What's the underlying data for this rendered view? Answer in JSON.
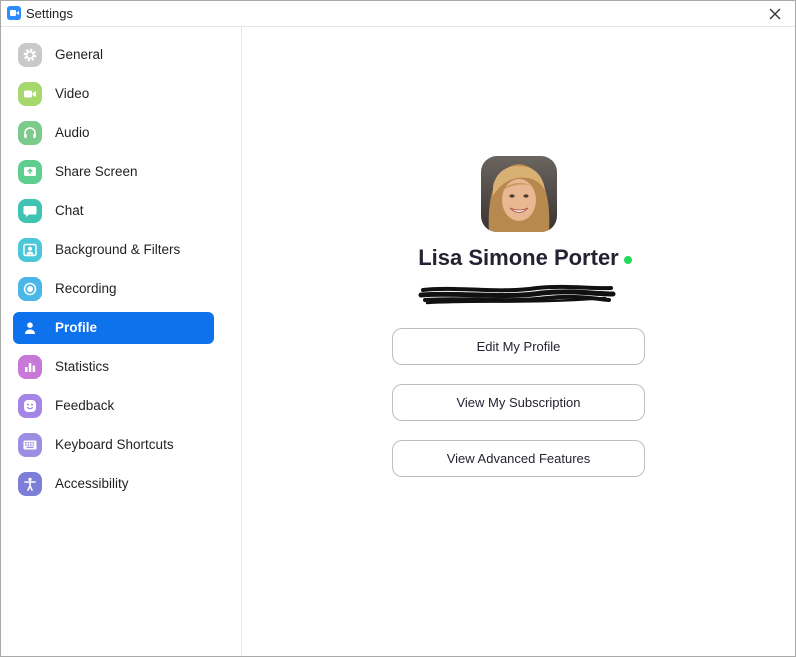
{
  "window": {
    "title": "Settings"
  },
  "sidebar": {
    "items": [
      {
        "label": "General",
        "icon": "gear-icon",
        "color": "#c4c4c4"
      },
      {
        "label": "Video",
        "icon": "video-camera-icon",
        "color": "#a6d86e"
      },
      {
        "label": "Audio",
        "icon": "headphones-icon",
        "color": "#7ccb8c"
      },
      {
        "label": "Share Screen",
        "icon": "share-screen-icon",
        "color": "#5fcf90"
      },
      {
        "label": "Chat",
        "icon": "chat-bubble-icon",
        "color": "#3fc3b2"
      },
      {
        "label": "Background & Filters",
        "icon": "background-person-icon",
        "color": "#4bc7d9"
      },
      {
        "label": "Recording",
        "icon": "record-icon",
        "color": "#4bb6e8"
      },
      {
        "label": "Profile",
        "icon": "person-icon",
        "color": "#0e72ed",
        "active": true
      },
      {
        "label": "Statistics",
        "icon": "bar-chart-icon",
        "color": "#c778d8"
      },
      {
        "label": "Feedback",
        "icon": "smiley-icon",
        "color": "#a585e6"
      },
      {
        "label": "Keyboard Shortcuts",
        "icon": "keyboard-icon",
        "color": "#9b8fe3"
      },
      {
        "label": "Accessibility",
        "icon": "accessibility-icon",
        "color": "#7d7fd6"
      }
    ]
  },
  "profile": {
    "name": "Lisa Simone Porter",
    "status_color": "#23d959",
    "buttons": {
      "edit": "Edit My Profile",
      "subscription": "View My Subscription",
      "advanced": "View Advanced Features"
    }
  },
  "colors": {
    "accent": "#0e72ed"
  }
}
